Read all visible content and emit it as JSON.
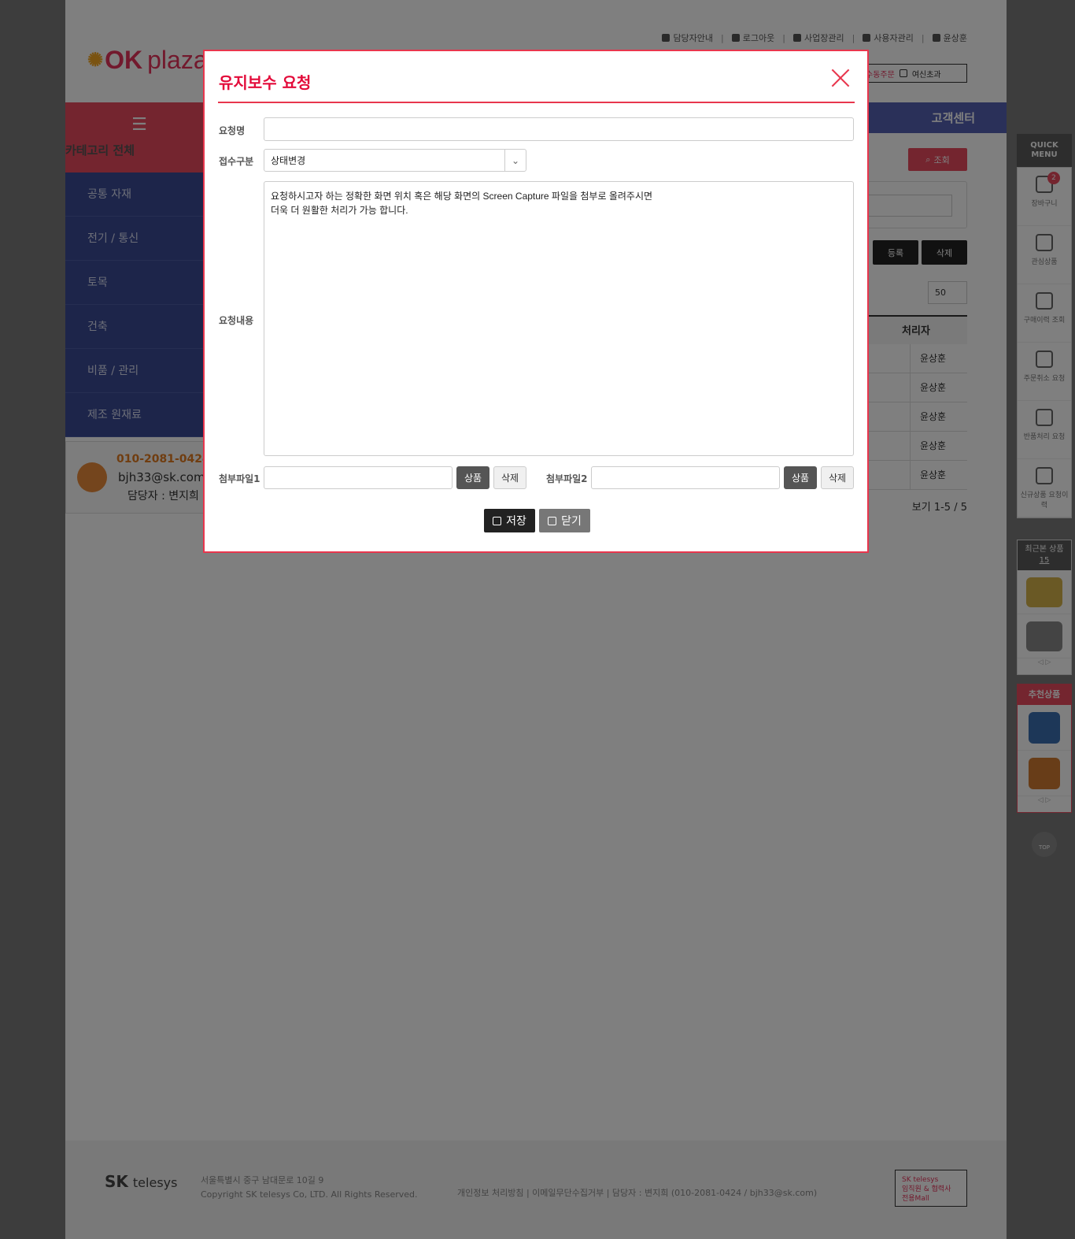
{
  "header": {
    "links": [
      "담당자안내",
      "로그아웃",
      "사업장관리",
      "사용자관리",
      "윤상훈"
    ],
    "logo_text": "OK",
    "logo_sub": "plaza",
    "checkbox_items": [
      "수동주문",
      "여신초과"
    ],
    "customer_center": "고객센터"
  },
  "sidebar": {
    "category_label": "카테고리 전체",
    "items": [
      "공통 자재",
      "전기 / 통신",
      "토목",
      "건축",
      "비품 / 관리",
      "제조 원재료"
    ],
    "contact": {
      "phone": "010-2081-0424",
      "email": "bjh33@sk.com",
      "manager": "담당자 : 변지희"
    }
  },
  "main": {
    "search_label": "조회",
    "register_label": "등록",
    "delete_label": "삭제",
    "per_page": "50",
    "table_header": "처리자",
    "table_rows": [
      "윤상훈",
      "윤상훈",
      "윤상훈",
      "윤상훈",
      "윤상훈"
    ],
    "view_count": "보기 1-5 / 5"
  },
  "quick_menu": {
    "title": "QUICK MENU",
    "items": [
      "장바구니",
      "관심상품",
      "구매이력 조회",
      "주문취소 요청",
      "반품처리 요청",
      "신규상품 요청이력"
    ],
    "cart_count": "2",
    "recent_title": "최근본 상품",
    "recent_count": "15",
    "reco_title": "추천상품",
    "top_label": "TOP"
  },
  "footer": {
    "logo": "SK",
    "logo_sub": "telesys",
    "address": "서울특별시 중구 남대문로 10길 9",
    "copyright": "Copyright SK telesys Co, LTD. All Rights Reserved.",
    "links": "개인정보 처리방침  |  이메일무단수집거부  |  담당자 : 변지희 (010-2081-0424 / bjh33@sk.com)",
    "badge_line1": "SK telesys",
    "badge_line2": "임직원 & 협력사",
    "badge_line3": "전용Mall"
  },
  "modal": {
    "title": "유지보수 요청",
    "field_name_label": "요청명",
    "field_name_value": "",
    "field_type_label": "접수구분",
    "field_type_value": "상태변경",
    "field_content_label": "요청내용",
    "field_content_value": "요청하시고자 하는 정확한 화면 위치 혹은 해당 화면의 Screen Capture 파일을 첨부로 올려주시면\n더욱 더 원활한 처리가 가능 합니다.",
    "attach1_label": "첨부파일1",
    "attach2_label": "첨부파일2",
    "attach_btn": "상품",
    "attach_del": "삭제",
    "save_label": "저장",
    "close_label": "닫기"
  }
}
